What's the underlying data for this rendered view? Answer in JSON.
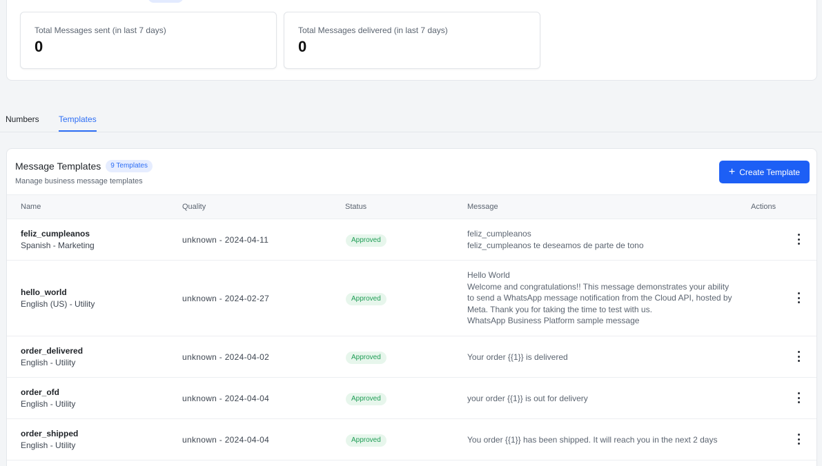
{
  "stats": {
    "sent_label": "Total Messages sent (in last 7 days)",
    "sent_value": "0",
    "delivered_label": "Total Messages delivered (in last 7 days)",
    "delivered_value": "0"
  },
  "tabs": [
    {
      "label": "Numbers",
      "active": false
    },
    {
      "label": "Templates",
      "active": true
    }
  ],
  "panel": {
    "title": "Message Templates",
    "count_badge": "9 Templates",
    "subtitle": "Manage business message templates",
    "create_button": "Create Template"
  },
  "table": {
    "columns": [
      "Name",
      "Quality",
      "Status",
      "Message",
      "Actions"
    ],
    "rows": [
      {
        "name": "feliz_cumpleanos",
        "sub": "Spanish - Marketing",
        "quality": "unknown - 2024-04-11",
        "status": "Approved",
        "message": [
          "feliz_cumpleanos",
          "feliz_cumpleanos te deseamos de parte de tono"
        ]
      },
      {
        "name": "hello_world",
        "sub": "English (US) - Utility",
        "quality": "unknown - 2024-02-27",
        "status": "Approved",
        "message": [
          "Hello World",
          "Welcome and congratulations!! This message demonstrates your ability to send a WhatsApp message notification from the Cloud API, hosted by Meta. Thank you for taking the time to test with us.",
          "WhatsApp Business Platform sample message"
        ]
      },
      {
        "name": "order_delivered",
        "sub": "English - Utility",
        "quality": "unknown - 2024-04-02",
        "status": "Approved",
        "message": [
          "Your order {{1}} is delivered"
        ]
      },
      {
        "name": "order_ofd",
        "sub": "English - Utility",
        "quality": "unknown - 2024-04-04",
        "status": "Approved",
        "message": [
          "your order {{1}} is out for delivery"
        ]
      },
      {
        "name": "order_shipped",
        "sub": "English - Utility",
        "quality": "unknown - 2024-04-04",
        "status": "Approved",
        "message": [
          "You order {{1}} has been shipped. It will reach you in the next 2 days"
        ]
      }
    ]
  },
  "colors": {
    "accent": "#1d5ff5",
    "approved_text": "#1f9d55",
    "approved_bg": "#e7f6ec"
  }
}
